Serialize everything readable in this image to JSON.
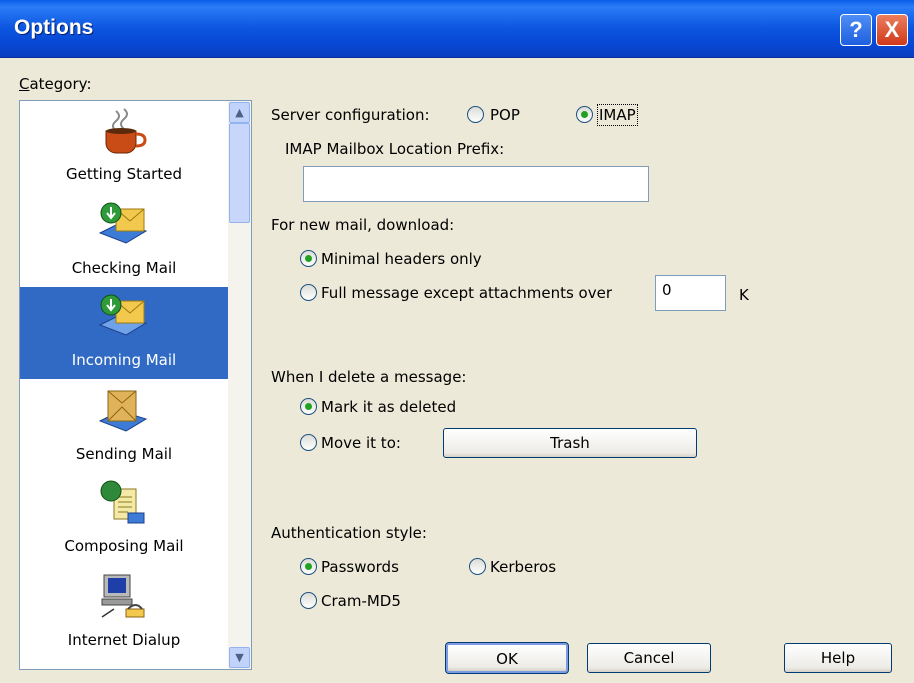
{
  "window": {
    "title": "Options",
    "help_glyph": "?",
    "close_glyph": "X"
  },
  "category": {
    "label": "Category:",
    "items": [
      {
        "label": "Getting Started",
        "icon": "coffee-cup-icon"
      },
      {
        "label": "Checking Mail",
        "icon": "mail-download-icon"
      },
      {
        "label": "Incoming Mail",
        "icon": "incoming-mail-icon",
        "selected": true
      },
      {
        "label": "Sending Mail",
        "icon": "outbox-icon"
      },
      {
        "label": "Composing Mail",
        "icon": "compose-icon"
      },
      {
        "label": "Internet Dialup",
        "icon": "computer-phone-icon"
      }
    ]
  },
  "server": {
    "label": "Server configuration:",
    "pop": "POP",
    "imap": "IMAP",
    "selected": "IMAP"
  },
  "imap_prefix": {
    "label": "IMAP Mailbox Location Prefix:",
    "value": ""
  },
  "download": {
    "label": "For new mail, download:",
    "minimal": "Minimal headers only",
    "full": "Full message except attachments over",
    "size_value": "0",
    "unit": "K",
    "selected": "minimal"
  },
  "delete": {
    "label": "When I delete a message:",
    "mark": "Mark it as deleted",
    "move": "Move it to:",
    "folder": "Trash",
    "selected": "mark"
  },
  "auth": {
    "label": "Authentication style:",
    "passwords": "Passwords",
    "kerberos": "Kerberos",
    "cram": "Cram-MD5",
    "selected": "passwords"
  },
  "buttons": {
    "ok": "OK",
    "cancel": "Cancel",
    "help": "Help"
  },
  "colors": {
    "selection": "#316ac5",
    "title_bar": "#0a5ee8",
    "dialog_bg": "#ece9d8"
  }
}
